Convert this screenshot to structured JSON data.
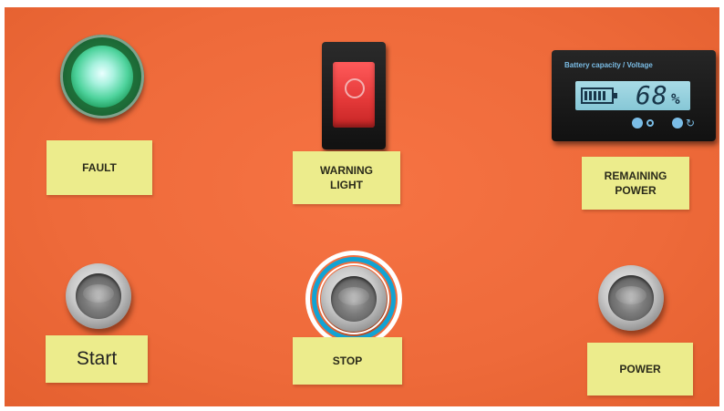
{
  "labels": {
    "fault": "FAULT",
    "warning_light": "WARNING\nLIGHT",
    "remaining_power": "REMAINING\nPOWER",
    "start": "Start",
    "stop": "STOP",
    "power": "POWER"
  },
  "battery_meter": {
    "caption": "Battery capacity / Voltage",
    "value": "68",
    "unit": "%",
    "button_right_symbol": "↻"
  },
  "colors": {
    "panel": "#f06c3b",
    "label": "#ecec8c",
    "fault_lamp": "#4fd39d",
    "rocker": "#e33838",
    "highlight_ring": "#11a3d4"
  }
}
